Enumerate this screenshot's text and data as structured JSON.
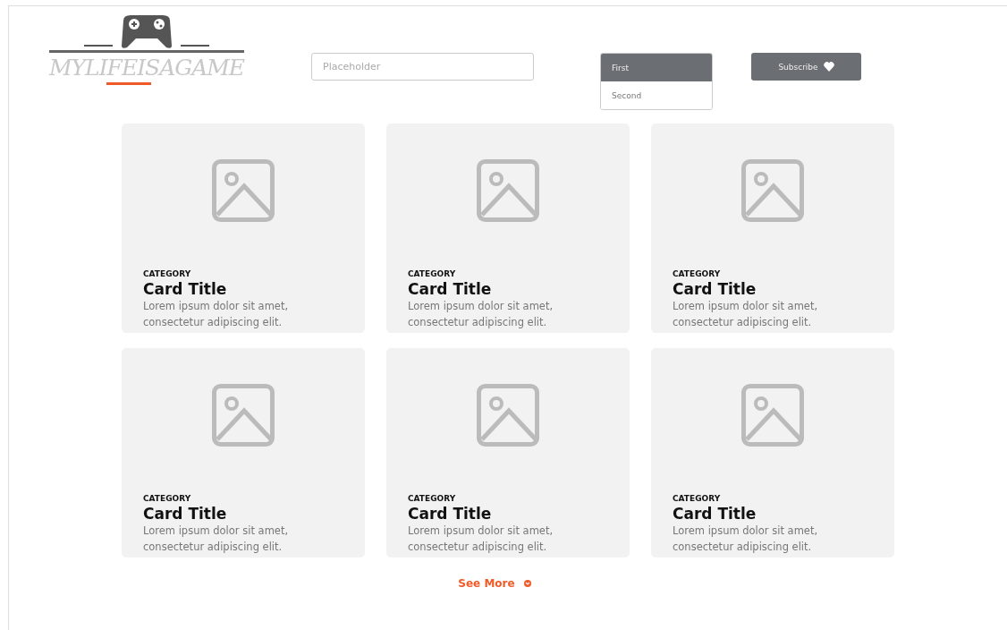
{
  "header": {
    "logo_text": "MYLIFEISAGAME",
    "search": {
      "placeholder": "Placeholder"
    },
    "dropdown": [
      {
        "label": "First",
        "selected": true
      },
      {
        "label": "Second",
        "selected": false
      }
    ],
    "subscribe_button": "Subscribe"
  },
  "cards": [
    {
      "category": "CATEGORY",
      "title": "Card Title",
      "text": "Lorem ipsum dolor sit amet, consectetur adipiscing elit."
    },
    {
      "category": "CATEGORY",
      "title": "Card Title",
      "text": "Lorem ipsum dolor sit amet, consectetur adipiscing elit."
    },
    {
      "category": "CATEGORY",
      "title": "Card Title",
      "text": "Lorem ipsum dolor sit amet, consectetur adipiscing elit."
    },
    {
      "category": "CATEGORY",
      "title": "Card Title",
      "text": "Lorem ipsum dolor sit amet, consectetur adipiscing elit."
    },
    {
      "category": "CATEGORY",
      "title": "Card Title",
      "text": "Lorem ipsum dolor sit amet, consectetur adipiscing elit."
    },
    {
      "category": "CATEGORY",
      "title": "Card Title",
      "text": "Lorem ipsum dolor sit amet, consectetur adipiscing elit."
    }
  ],
  "see_more": "See More"
}
